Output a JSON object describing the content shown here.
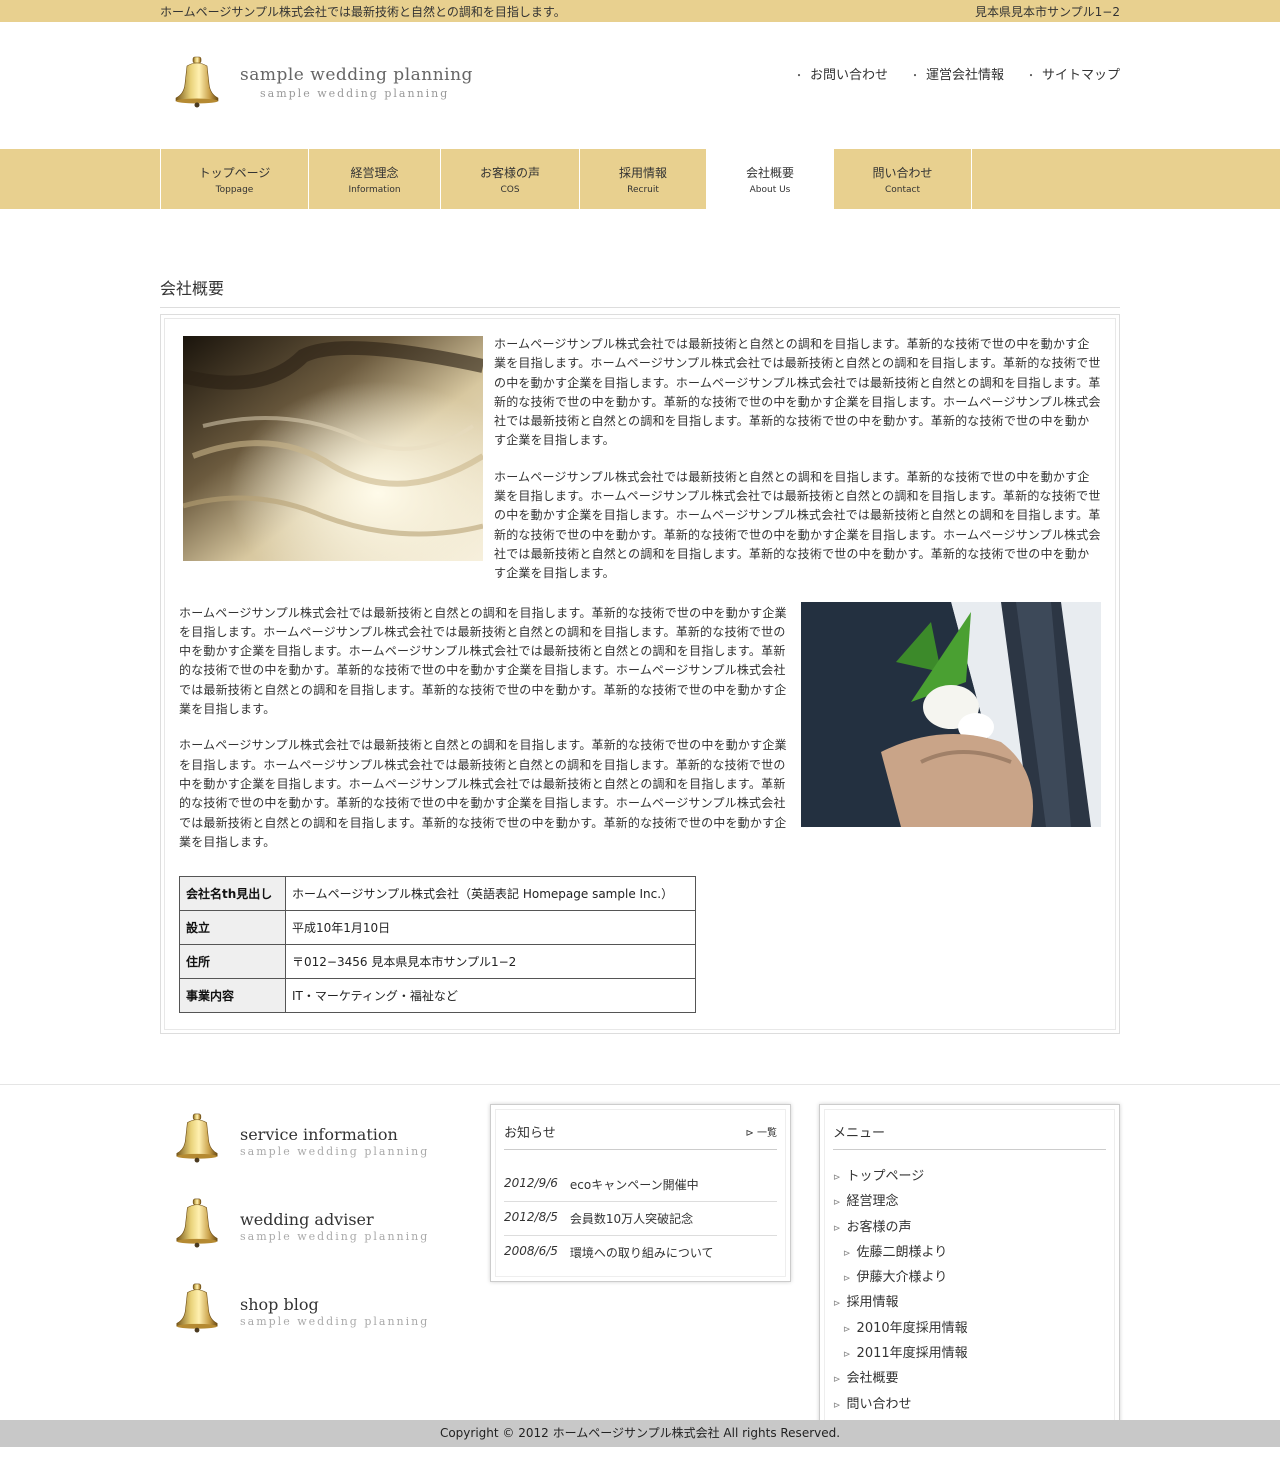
{
  "topbar": {
    "tagline": "ホームページサンプル株式会社では最新技術と自然との調和を目指します。",
    "address": "見本県見本市サンプル1−2"
  },
  "header": {
    "logo_title": "sample wedding  planning",
    "logo_sub": "sample wedding planning",
    "links": [
      "お問い合わせ",
      "運営会社情報",
      "サイトマップ"
    ]
  },
  "nav": {
    "items": [
      {
        "jp": "トップページ",
        "en": "Toppage"
      },
      {
        "jp": "経営理念",
        "en": "Information"
      },
      {
        "jp": "お客様の声",
        "en": "COS"
      },
      {
        "jp": "採用情報",
        "en": "Recruit"
      },
      {
        "jp": "会社概要",
        "en": "About Us"
      },
      {
        "jp": "問い合わせ",
        "en": "Contact"
      }
    ],
    "active": "会社概要"
  },
  "main": {
    "title": "会社概要",
    "paragraph": "ホームページサンプル株式会社では最新技術と自然との調和を目指します。革新的な技術で世の中を動かす企業を目指します。ホームページサンプル株式会社では最新技術と自然との調和を目指します。革新的な技術で世の中を動かす企業を目指します。ホームページサンプル株式会社では最新技術と自然との調和を目指します。革新的な技術で世の中を動かす。革新的な技術で世の中を動かす企業を目指します。ホームページサンプル株式会社では最新技術と自然との調和を目指します。革新的な技術で世の中を動かす。革新的な技術で世の中を動かす企業を目指します。",
    "table": [
      {
        "th": "会社名th見出し",
        "td": "ホームページサンプル株式会社（英語表記 Homepage sample Inc.）"
      },
      {
        "th": "設立",
        "td": "平成10年1月10日"
      },
      {
        "th": "住所",
        "td": "〒012−3456 見本県見本市サンプル1−2"
      },
      {
        "th": "事業内容",
        "td": "IT・マーケティング・福祉など"
      }
    ]
  },
  "footer": {
    "services": [
      {
        "title": "service information",
        "sub": "sample wedding planning"
      },
      {
        "title": "wedding adviser",
        "sub": "sample wedding planning"
      },
      {
        "title": "shop blog",
        "sub": "sample wedding planning"
      }
    ],
    "news": {
      "heading": "お知らせ",
      "more": "一覧",
      "items": [
        {
          "date": "2012/9/6",
          "text": "ecoキャンペーン開催中"
        },
        {
          "date": "2012/8/5",
          "text": "会員数10万人突破記念"
        },
        {
          "date": "2008/6/5",
          "text": "環境への取り組みについて"
        }
      ]
    },
    "menu": {
      "heading": "メニュー",
      "items": [
        {
          "label": "トップページ",
          "sub": false
        },
        {
          "label": "経営理念",
          "sub": false
        },
        {
          "label": "お客様の声",
          "sub": false
        },
        {
          "label": "佐藤二朗様より",
          "sub": true
        },
        {
          "label": "伊藤大介様より",
          "sub": true
        },
        {
          "label": "採用情報",
          "sub": false
        },
        {
          "label": "2010年度採用情報",
          "sub": true
        },
        {
          "label": "2011年度採用情報",
          "sub": true
        },
        {
          "label": "会社概要",
          "sub": false
        },
        {
          "label": "問い合わせ",
          "sub": false
        }
      ]
    },
    "copyright": "Copyright © 2012 ホームページサンプル株式会社 All rights Reserved."
  },
  "colors": {
    "accent": "#e8d08f",
    "footer_bar": "#c8c8c8"
  }
}
